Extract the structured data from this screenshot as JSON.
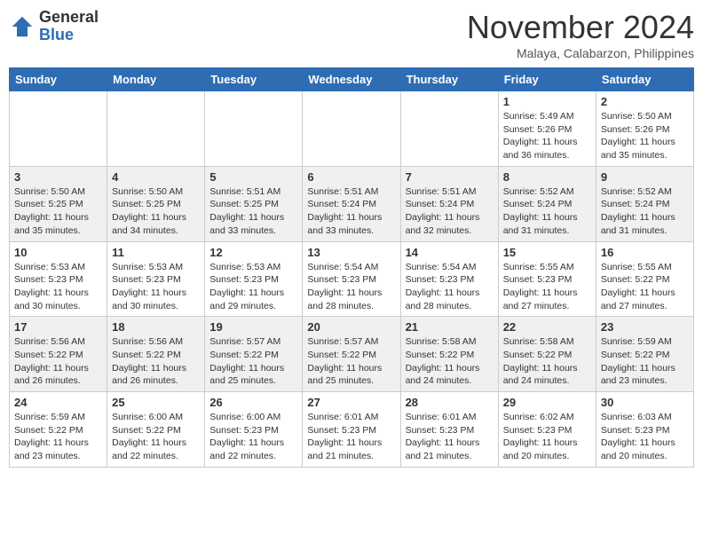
{
  "header": {
    "logo_general": "General",
    "logo_blue": "Blue",
    "month": "November 2024",
    "location": "Malaya, Calabarzon, Philippines"
  },
  "days_of_week": [
    "Sunday",
    "Monday",
    "Tuesday",
    "Wednesday",
    "Thursday",
    "Friday",
    "Saturday"
  ],
  "weeks": [
    [
      {
        "day": "",
        "info": ""
      },
      {
        "day": "",
        "info": ""
      },
      {
        "day": "",
        "info": ""
      },
      {
        "day": "",
        "info": ""
      },
      {
        "day": "",
        "info": ""
      },
      {
        "day": "1",
        "info": "Sunrise: 5:49 AM\nSunset: 5:26 PM\nDaylight: 11 hours and 36 minutes."
      },
      {
        "day": "2",
        "info": "Sunrise: 5:50 AM\nSunset: 5:26 PM\nDaylight: 11 hours and 35 minutes."
      }
    ],
    [
      {
        "day": "3",
        "info": "Sunrise: 5:50 AM\nSunset: 5:25 PM\nDaylight: 11 hours and 35 minutes."
      },
      {
        "day": "4",
        "info": "Sunrise: 5:50 AM\nSunset: 5:25 PM\nDaylight: 11 hours and 34 minutes."
      },
      {
        "day": "5",
        "info": "Sunrise: 5:51 AM\nSunset: 5:25 PM\nDaylight: 11 hours and 33 minutes."
      },
      {
        "day": "6",
        "info": "Sunrise: 5:51 AM\nSunset: 5:24 PM\nDaylight: 11 hours and 33 minutes."
      },
      {
        "day": "7",
        "info": "Sunrise: 5:51 AM\nSunset: 5:24 PM\nDaylight: 11 hours and 32 minutes."
      },
      {
        "day": "8",
        "info": "Sunrise: 5:52 AM\nSunset: 5:24 PM\nDaylight: 11 hours and 31 minutes."
      },
      {
        "day": "9",
        "info": "Sunrise: 5:52 AM\nSunset: 5:24 PM\nDaylight: 11 hours and 31 minutes."
      }
    ],
    [
      {
        "day": "10",
        "info": "Sunrise: 5:53 AM\nSunset: 5:23 PM\nDaylight: 11 hours and 30 minutes."
      },
      {
        "day": "11",
        "info": "Sunrise: 5:53 AM\nSunset: 5:23 PM\nDaylight: 11 hours and 30 minutes."
      },
      {
        "day": "12",
        "info": "Sunrise: 5:53 AM\nSunset: 5:23 PM\nDaylight: 11 hours and 29 minutes."
      },
      {
        "day": "13",
        "info": "Sunrise: 5:54 AM\nSunset: 5:23 PM\nDaylight: 11 hours and 28 minutes."
      },
      {
        "day": "14",
        "info": "Sunrise: 5:54 AM\nSunset: 5:23 PM\nDaylight: 11 hours and 28 minutes."
      },
      {
        "day": "15",
        "info": "Sunrise: 5:55 AM\nSunset: 5:23 PM\nDaylight: 11 hours and 27 minutes."
      },
      {
        "day": "16",
        "info": "Sunrise: 5:55 AM\nSunset: 5:22 PM\nDaylight: 11 hours and 27 minutes."
      }
    ],
    [
      {
        "day": "17",
        "info": "Sunrise: 5:56 AM\nSunset: 5:22 PM\nDaylight: 11 hours and 26 minutes."
      },
      {
        "day": "18",
        "info": "Sunrise: 5:56 AM\nSunset: 5:22 PM\nDaylight: 11 hours and 26 minutes."
      },
      {
        "day": "19",
        "info": "Sunrise: 5:57 AM\nSunset: 5:22 PM\nDaylight: 11 hours and 25 minutes."
      },
      {
        "day": "20",
        "info": "Sunrise: 5:57 AM\nSunset: 5:22 PM\nDaylight: 11 hours and 25 minutes."
      },
      {
        "day": "21",
        "info": "Sunrise: 5:58 AM\nSunset: 5:22 PM\nDaylight: 11 hours and 24 minutes."
      },
      {
        "day": "22",
        "info": "Sunrise: 5:58 AM\nSunset: 5:22 PM\nDaylight: 11 hours and 24 minutes."
      },
      {
        "day": "23",
        "info": "Sunrise: 5:59 AM\nSunset: 5:22 PM\nDaylight: 11 hours and 23 minutes."
      }
    ],
    [
      {
        "day": "24",
        "info": "Sunrise: 5:59 AM\nSunset: 5:22 PM\nDaylight: 11 hours and 23 minutes."
      },
      {
        "day": "25",
        "info": "Sunrise: 6:00 AM\nSunset: 5:22 PM\nDaylight: 11 hours and 22 minutes."
      },
      {
        "day": "26",
        "info": "Sunrise: 6:00 AM\nSunset: 5:23 PM\nDaylight: 11 hours and 22 minutes."
      },
      {
        "day": "27",
        "info": "Sunrise: 6:01 AM\nSunset: 5:23 PM\nDaylight: 11 hours and 21 minutes."
      },
      {
        "day": "28",
        "info": "Sunrise: 6:01 AM\nSunset: 5:23 PM\nDaylight: 11 hours and 21 minutes."
      },
      {
        "day": "29",
        "info": "Sunrise: 6:02 AM\nSunset: 5:23 PM\nDaylight: 11 hours and 20 minutes."
      },
      {
        "day": "30",
        "info": "Sunrise: 6:03 AM\nSunset: 5:23 PM\nDaylight: 11 hours and 20 minutes."
      }
    ]
  ]
}
